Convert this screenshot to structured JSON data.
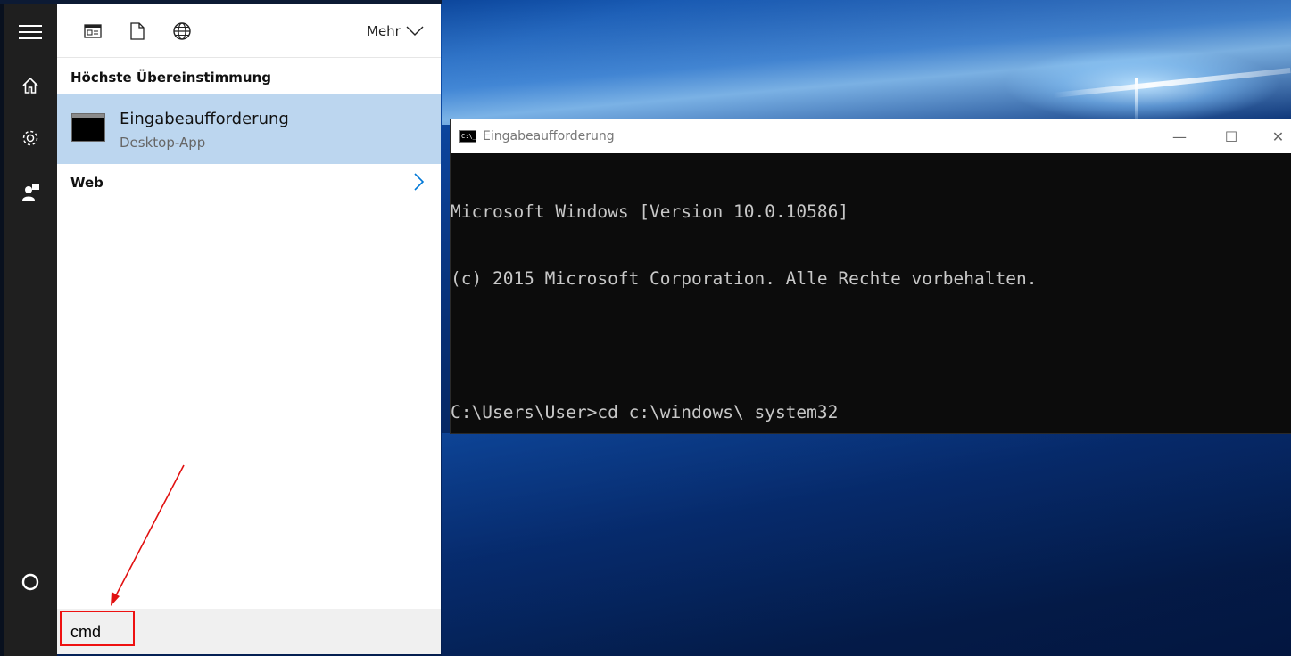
{
  "start_rail": {
    "icons": [
      "hamburger-menu-icon",
      "home-icon",
      "settings-gear-icon",
      "feedback-icon",
      "cortana-circle-icon"
    ]
  },
  "search_panel": {
    "toolbar": {
      "icons": [
        "apps-filter-icon",
        "documents-filter-icon",
        "web-filter-icon"
      ],
      "more_label": "Mehr"
    },
    "best_match_heading": "Höchste Übereinstimmung",
    "best_match": {
      "title": "Eingabeaufforderung",
      "subtitle": "Desktop-App"
    },
    "web_heading": "Web",
    "search": {
      "value": "cmd"
    }
  },
  "cmd_window": {
    "title": "Eingabeaufforderung",
    "icon_text": "C:\\_",
    "buttons": {
      "minimize": "—",
      "maximize": "☐",
      "close": "✕"
    },
    "lines": [
      "Microsoft Windows [Version 10.0.10586]",
      "(c) 2015 Microsoft Corporation. Alle Rechte vorbehalten.",
      "",
      "C:\\Users\\User>cd c:\\windows\\ system32"
    ]
  },
  "annotation": {
    "color": "#e11111"
  }
}
